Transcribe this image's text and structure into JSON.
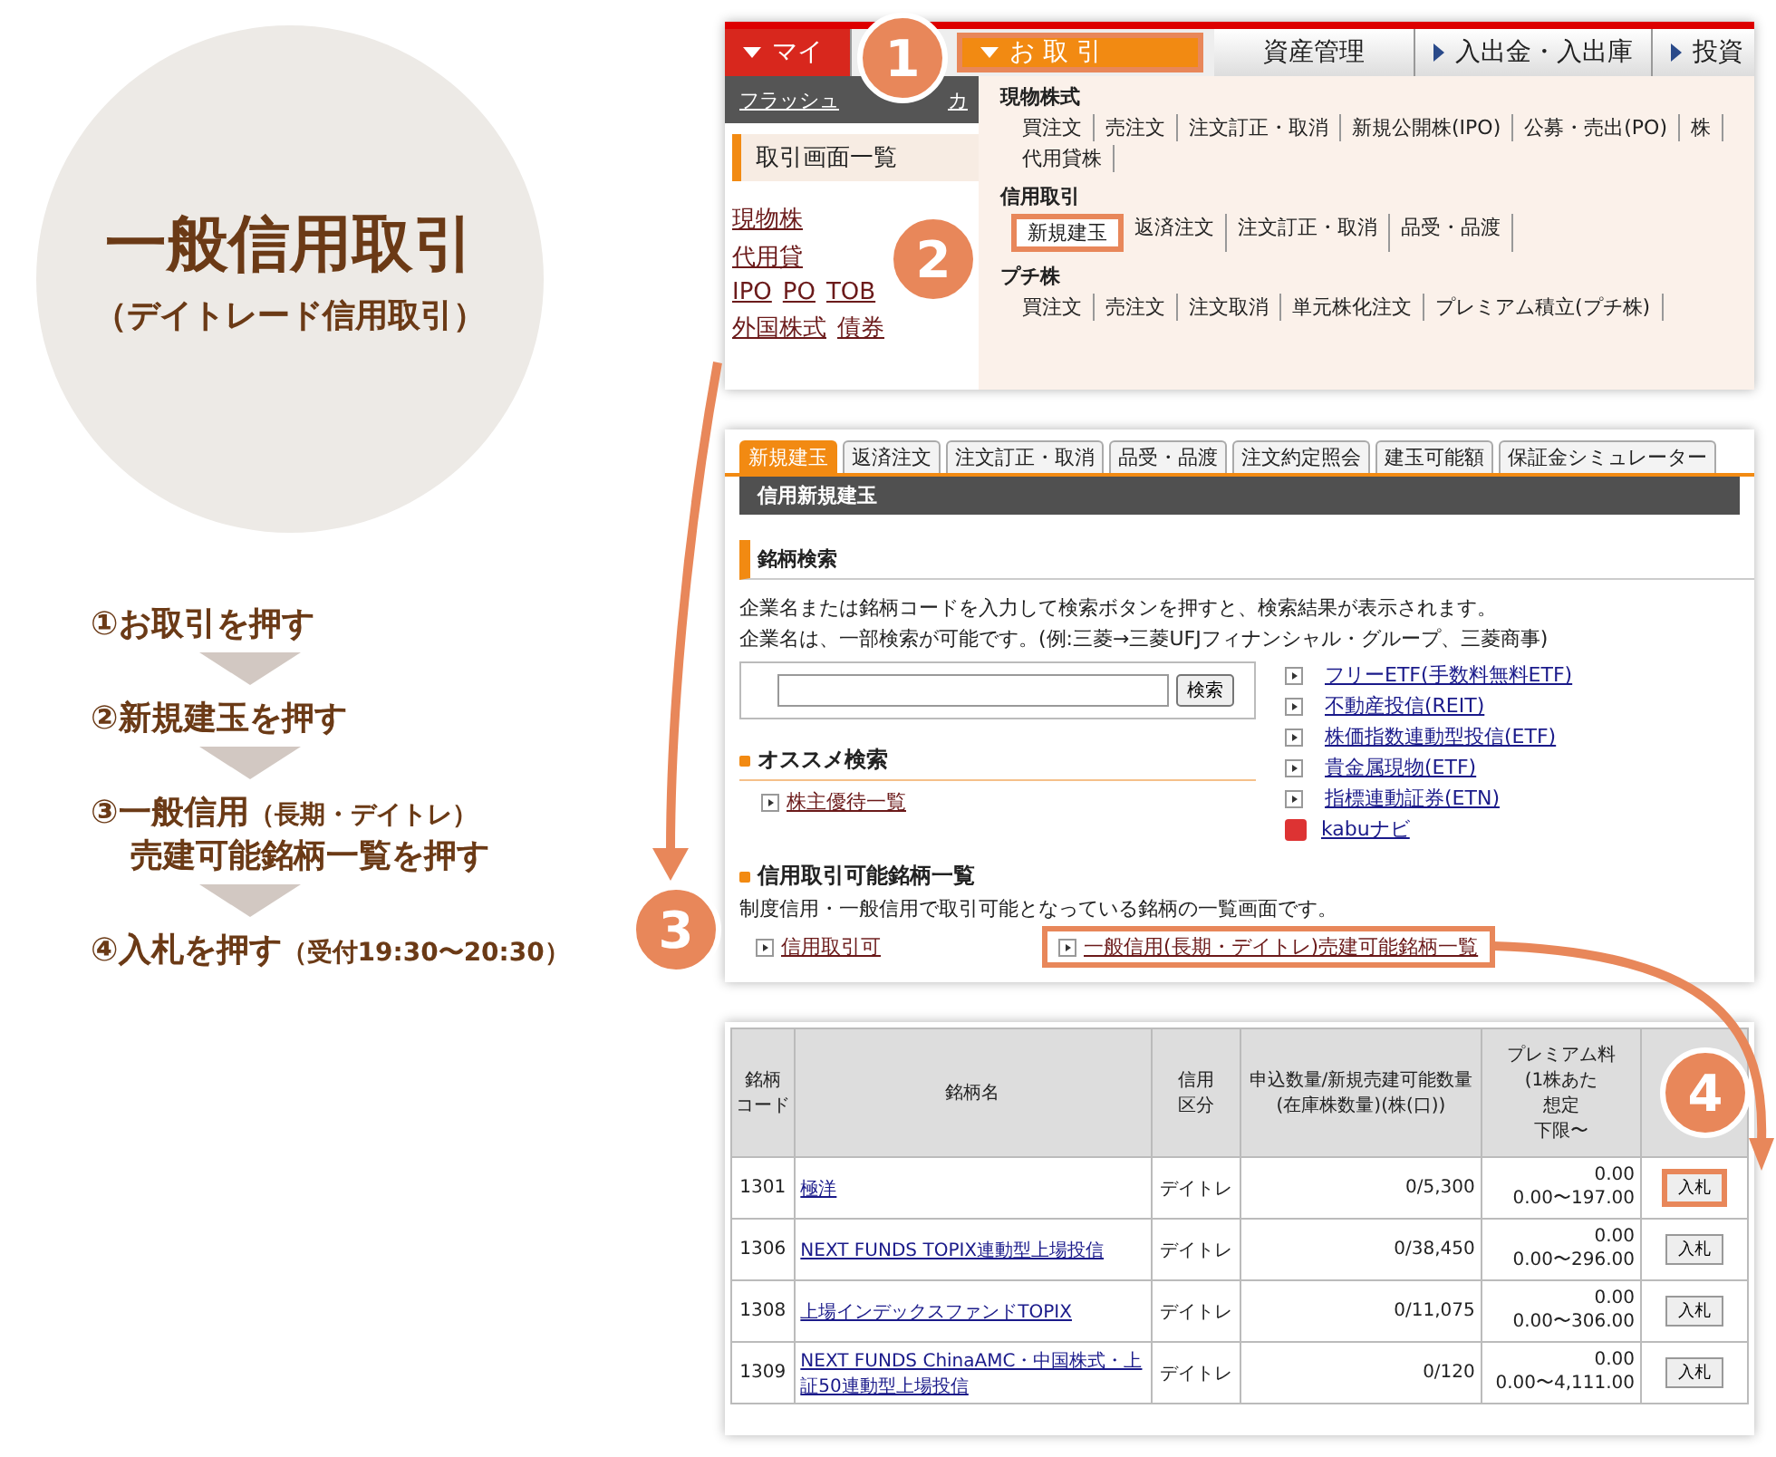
{
  "title": {
    "main": "一般信用取引",
    "sub": "（デイトレード信用取引）"
  },
  "steps": [
    {
      "number": "①",
      "text": "お取引を押す"
    },
    {
      "number": "②",
      "text": "新規建玉を押す"
    },
    {
      "number": "③",
      "text": "一般信用",
      "note": "（長期・デイトレ）",
      "line2": "売建可能銘柄一覧を押す"
    },
    {
      "number": "④",
      "text": "入札を押す",
      "note": "（受付19:30〜20:30）"
    }
  ],
  "callouts": [
    "1",
    "2",
    "3",
    "4"
  ],
  "menu_screen": {
    "nav_tabs": [
      {
        "label": "マイ",
        "kind": "red",
        "highlighted": false
      },
      {
        "label": "お 取 引",
        "kind": "orange",
        "highlighted": true
      },
      {
        "label": "資産管理",
        "kind": "plain",
        "highlighted": false
      },
      {
        "label": "入出金・入出庫",
        "kind": "arrow",
        "highlighted": false
      },
      {
        "label": "投資",
        "kind": "arrow",
        "highlighted": false
      }
    ],
    "toolbar_links": [
      "フラッシュ",
      "カ"
    ],
    "sidebar_title": "取引画面一覧",
    "sidebar_rows": [
      [
        "現物株"
      ],
      [
        "代用貸"
      ],
      [
        "IPO",
        "PO",
        "TOB"
      ],
      [
        "外国株式",
        "債券"
      ]
    ],
    "dropdown": [
      {
        "title": "現物株式",
        "items": [
          {
            "label": "買注文",
            "highlighted": false
          },
          {
            "label": "売注文",
            "highlighted": false
          },
          {
            "label": "注文訂正・取消",
            "highlighted": false
          },
          {
            "label": "新規公開株(IPO)",
            "highlighted": false
          },
          {
            "label": "公募・売出(PO)",
            "highlighted": false
          },
          {
            "label": "株",
            "highlighted": false
          },
          {
            "label": "代用貸株",
            "highlighted": false
          }
        ]
      },
      {
        "title": "信用取引",
        "items": [
          {
            "label": "新規建玉",
            "highlighted": true
          },
          {
            "label": "返済注文",
            "highlighted": false
          },
          {
            "label": "注文訂正・取消",
            "highlighted": false
          },
          {
            "label": "品受・品渡",
            "highlighted": false
          }
        ]
      },
      {
        "title": "プチ株",
        "items": [
          {
            "label": "買注文",
            "highlighted": false
          },
          {
            "label": "売注文",
            "highlighted": false
          },
          {
            "label": "注文取消",
            "highlighted": false
          },
          {
            "label": "単元株化注文",
            "highlighted": false
          },
          {
            "label": "プレミアム積立(プチ株)",
            "highlighted": false
          }
        ]
      }
    ]
  },
  "order_screen": {
    "tabs": [
      {
        "label": "新規建玉",
        "selected": true
      },
      {
        "label": "返済注文",
        "selected": false
      },
      {
        "label": "注文訂正・取消",
        "selected": false
      },
      {
        "label": "品受・品渡",
        "selected": false
      },
      {
        "label": "注文約定照会",
        "selected": false
      },
      {
        "label": "建玉可能額",
        "selected": false
      },
      {
        "label": "保証金シミュレーター",
        "selected": false
      }
    ],
    "header": "信用新規建玉",
    "search_section": "銘柄検索",
    "description": [
      "企業名または銘柄コードを入力して検索ボタンを押すと、検索結果が表示されます。",
      "企業名は、一部検索が可能です。(例:三菱→三菱UFJフィナンシャル・グループ、三菱商事)"
    ],
    "search_button": "検索",
    "quick_links": [
      {
        "label": "フリーETF(手数料無料ETF)",
        "kind": "arrow"
      },
      {
        "label": "不動産投信(REIT)",
        "kind": "arrow"
      },
      {
        "label": "株価指数連動型投信(ETF)",
        "kind": "arrow"
      },
      {
        "label": "貴金属現物(ETF)",
        "kind": "arrow"
      },
      {
        "label": "指標連動証券(ETN)",
        "kind": "arrow"
      },
      {
        "label": "kabuナビ",
        "kind": "app"
      }
    ],
    "recommend_title": "オススメ検索",
    "recommend_link": "株主優待一覧",
    "list_title": "信用取引可能銘柄一覧",
    "list_description": "制度信用・一般信用で取引可能となっている銘柄の一覧画面です。",
    "list_links": [
      {
        "label": "信用取引可",
        "highlighted": false
      },
      {
        "label": "一般信用(長期・デイトレ)売建可能銘柄一覧",
        "highlighted": true
      }
    ]
  },
  "stock_table": {
    "columns": [
      [
        "銘柄",
        "コード"
      ],
      [
        "銘柄名"
      ],
      [
        "信用",
        "区分"
      ],
      [
        "申込数量/新規売建可能数量",
        "(在庫株数量)(株(口))"
      ],
      [
        "プレミアム料",
        "(1株あた",
        "想定",
        "下限〜"
      ],
      []
    ],
    "rows": [
      {
        "code": "1301",
        "name": "極洋",
        "kubun": "デイトレ",
        "quantity": "0/5,300",
        "premium": "0.00",
        "range": "0.00〜197.00",
        "button": "入札",
        "highlighted": true
      },
      {
        "code": "1306",
        "name": "NEXT FUNDS TOPIX連動型上場投信",
        "kubun": "デイトレ",
        "quantity": "0/38,450",
        "premium": "0.00",
        "range": "0.00〜296.00",
        "button": "入札",
        "highlighted": false
      },
      {
        "code": "1308",
        "name": "上場インデックスファンドTOPIX",
        "kubun": "デイトレ",
        "quantity": "0/11,075",
        "premium": "0.00",
        "range": "0.00〜306.00",
        "button": "入札",
        "highlighted": false
      },
      {
        "code": "1309",
        "name": "NEXT FUNDS ChinaAMC・中国株式・上証50連動型上場投信",
        "kubun": "デイトレ",
        "quantity": "0/120",
        "premium": "0.00",
        "range": "0.00〜4,111.00",
        "button": "入札",
        "highlighted": false
      }
    ]
  }
}
